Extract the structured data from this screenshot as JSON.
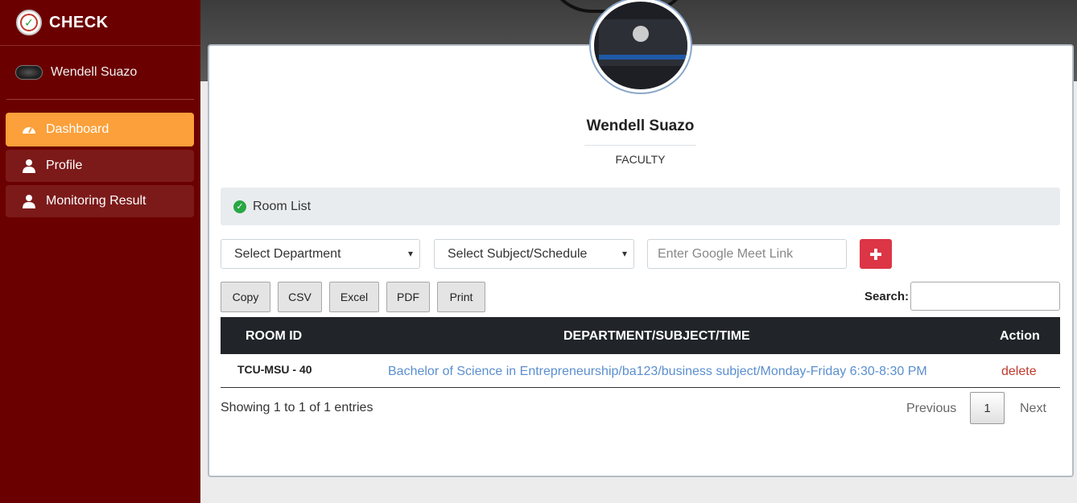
{
  "brand": {
    "name": "CHECK"
  },
  "sidebar": {
    "user_name": "Wendell Suazo",
    "items": [
      {
        "label": "Dashboard",
        "icon": "dashboard-icon",
        "active": true
      },
      {
        "label": "Profile",
        "icon": "user-icon",
        "active": false
      },
      {
        "label": "Monitoring Result",
        "icon": "user-icon",
        "active": false
      }
    ]
  },
  "profile": {
    "name": "Wendell Suazo",
    "role": "FACULTY"
  },
  "room_list": {
    "title": "Room List"
  },
  "form": {
    "department_select": "Select Department",
    "subject_select": "Select Subject/Schedule",
    "meet_link_placeholder": "Enter Google Meet Link",
    "add_icon": "plus-icon"
  },
  "export_buttons": [
    "Copy",
    "CSV",
    "Excel",
    "PDF",
    "Print"
  ],
  "search": {
    "label": "Search:"
  },
  "table": {
    "headers": [
      "ROOM ID",
      "DEPARTMENT/SUBJECT/TIME",
      "Action"
    ],
    "rows": [
      {
        "room_id": "TCU-MSU - 40",
        "details": "Bachelor of Science in Entrepreneurship/ba123/business subject/Monday-Friday 6:30-8:30 PM",
        "action": "delete"
      }
    ]
  },
  "pagination": {
    "info": "Showing 1 to 1 of 1 entries",
    "previous": "Previous",
    "page": "1",
    "next": "Next"
  },
  "colors": {
    "sidebar": "#6b0000",
    "active": "#fba03a",
    "danger": "#dc3545",
    "link": "#5b8fcf"
  }
}
